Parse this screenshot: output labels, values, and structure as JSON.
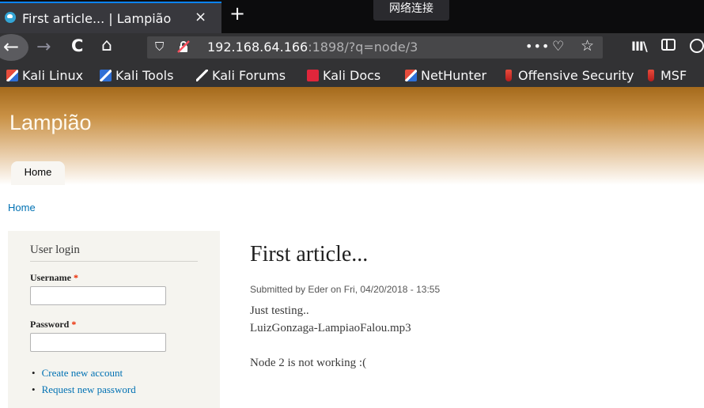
{
  "browser": {
    "tab_title": "First article... | Lampião",
    "tab_close": "×",
    "new_tab": "+",
    "network_popup": "网络连接",
    "url_host": "192.168.64.166",
    "url_rest": ":1898/?q=node/3",
    "url_more": "•••",
    "icons": {
      "back": "←",
      "forward": "→",
      "reload": "C",
      "home": "⌂",
      "shield": "⛉",
      "pocket": "♡",
      "star": "☆",
      "library": "III\\"
    },
    "bookmarks": [
      "Kali Linux",
      "Kali Tools",
      "Kali Forums",
      "Kali Docs",
      "NetHunter",
      "Offensive Security",
      "MSF"
    ]
  },
  "site": {
    "name": "Lampião",
    "nav_tab": "Home",
    "breadcrumb": "Home"
  },
  "login": {
    "title": "User login",
    "username_label": "Username",
    "password_label": "Password",
    "required_mark": "*",
    "links": [
      "Create new account",
      "Request new password"
    ]
  },
  "article": {
    "title": "First article...",
    "meta": "Submitted by Eder on Fri, 04/20/2018 - 13:55",
    "lines": [
      "Just testing..",
      "LuizGonzaga-LampiaoFalou.mp3",
      "Node 2 is not working :("
    ]
  }
}
